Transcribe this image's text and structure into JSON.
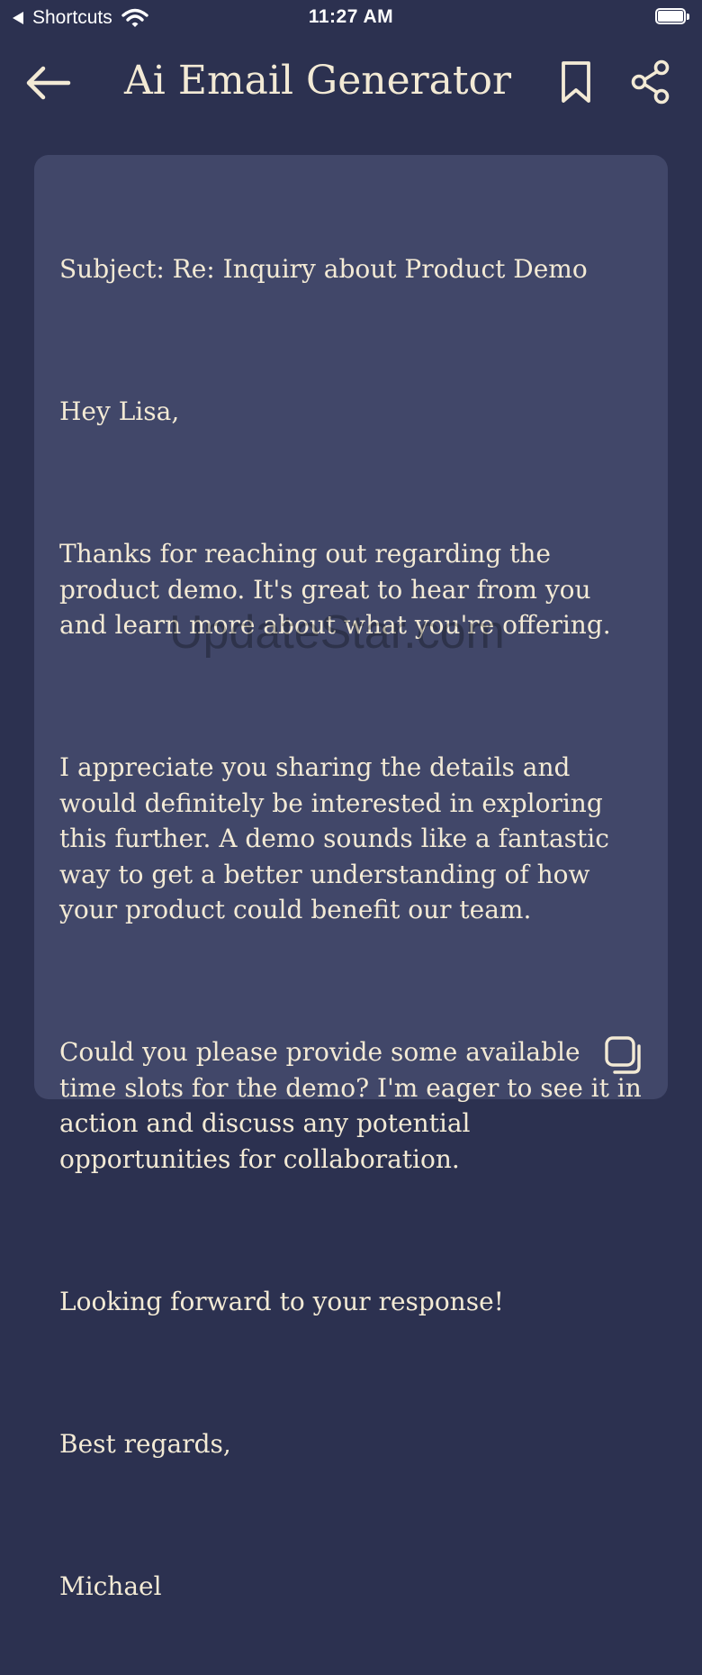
{
  "status_bar": {
    "back_app": "Shortcuts",
    "time": "11:27 AM"
  },
  "nav": {
    "title": "Ai Email Generator",
    "back_icon": "arrow-left-icon",
    "bookmark_icon": "bookmark-icon",
    "share_icon": "share-icon"
  },
  "email": {
    "subject": "Subject: Re: Inquiry about Product Demo",
    "greeting": "Hey Lisa,",
    "paragraph_1": "Thanks for reaching out regarding the product demo. It's great to hear from you and learn more about what you're offering.",
    "paragraph_2": "I appreciate you sharing the details and would definitely be interested in exploring this further. A demo sounds like a fantastic way to get a better understanding of how your product could benefit our team.",
    "paragraph_3": "Could you please provide some available time slots for the demo? I'm eager to see it in action and discuss any potential opportunities for collaboration.",
    "closing_line": "Looking forward to your response!",
    "sign_off": "Best regards,",
    "signature": "Michael"
  },
  "watermark": "UpdateStar.com",
  "copy_icon": "copy-icon",
  "colors": {
    "background": "#2c3150",
    "card": "#414769",
    "text": "#f3ead5"
  }
}
